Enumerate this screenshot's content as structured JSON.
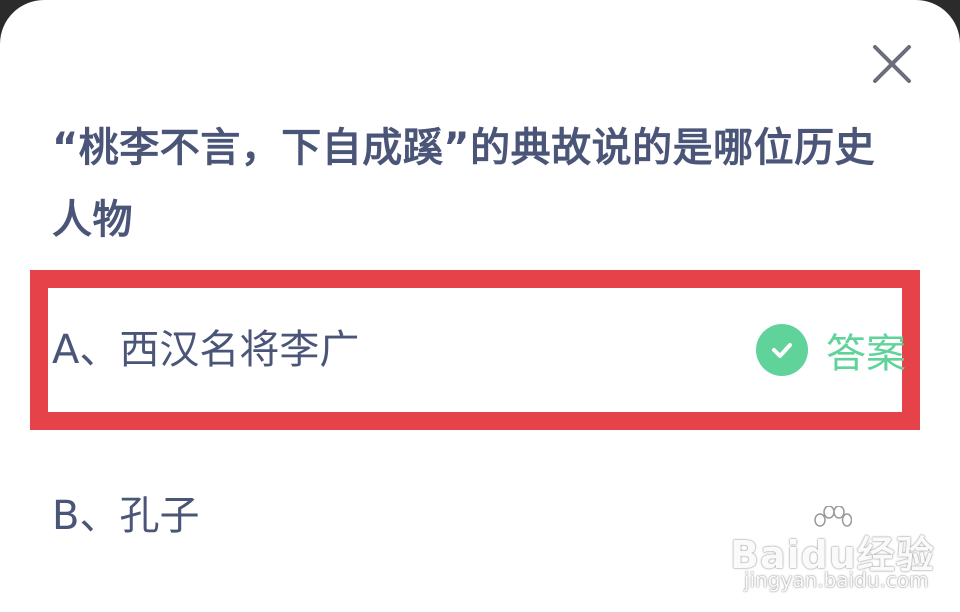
{
  "question": {
    "text": "“桃李不言，下自成蹊”的典故说的是哪位历史人物"
  },
  "options": [
    {
      "label": "A、西汉名将李广",
      "answer_label": "答案",
      "selected": true
    },
    {
      "label": "B、孔子"
    }
  ],
  "close": {
    "icon": "close-icon"
  },
  "watermark": {
    "logo_text": "Baidu经验",
    "sub_text": "jingyan.baidu.com"
  },
  "colors": {
    "question_text": "#4a5578",
    "highlight_border": "#e5424a",
    "answer_green": "#5fd39a",
    "background": "#ffffff"
  }
}
